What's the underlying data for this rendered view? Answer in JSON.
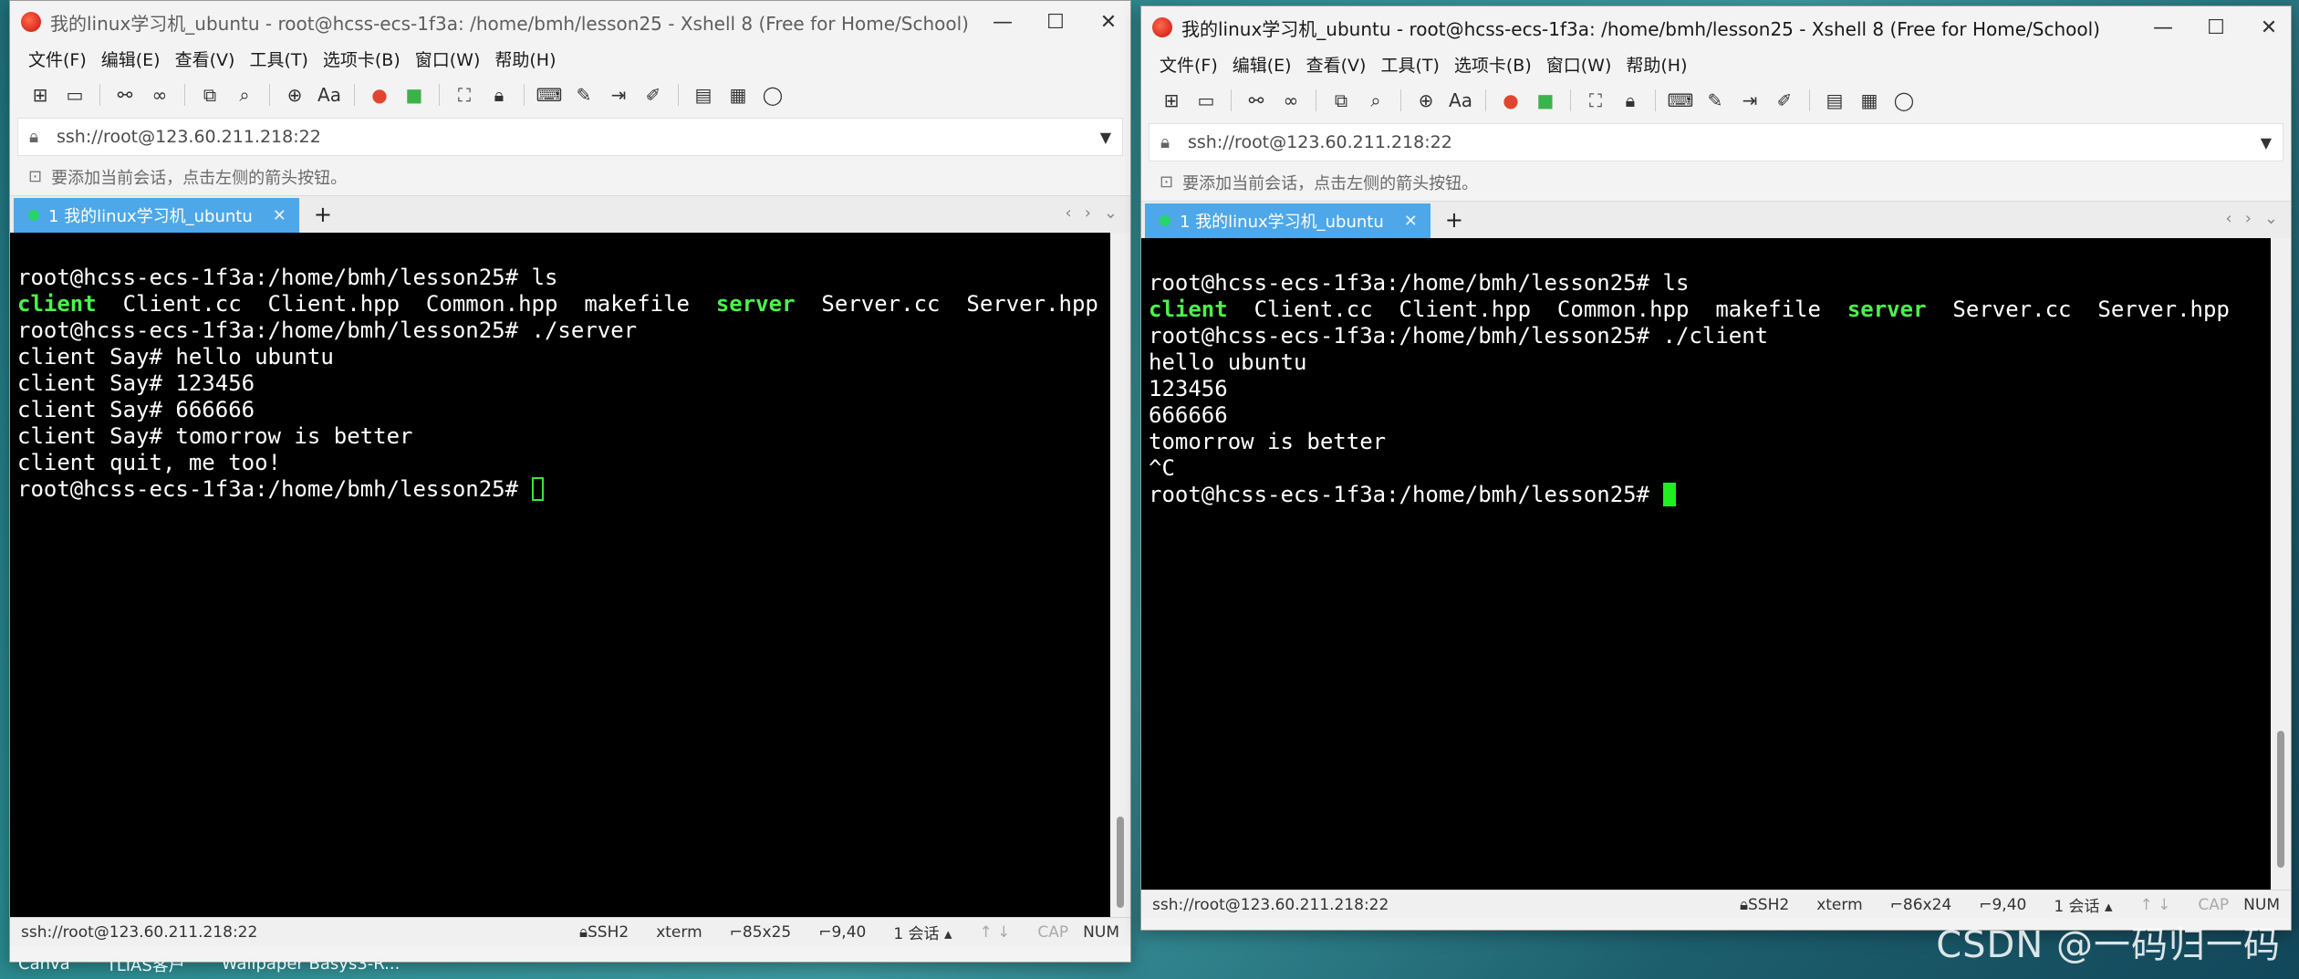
{
  "desktop": {
    "taskbar_items": [
      "Canva",
      "TLIAS客户",
      "Wallpaper Basys3-R..."
    ],
    "watermark": "CSDN @一码归一码"
  },
  "windows": [
    {
      "title": "我的linux学习机_ubuntu - root@hcss-ecs-1f3a: /home/bmh/lesson25 - Xshell 8 (Free for Home/School)",
      "menu": [
        "文件(F)",
        "编辑(E)",
        "查看(V)",
        "工具(T)",
        "选项卡(B)",
        "窗口(W)",
        "帮助(H)"
      ],
      "address": "ssh://root@123.60.211.218:22",
      "hint": "要添加当前会话，点击左侧的箭头按钮。",
      "tab_label": "1 我的linux学习机_ubuntu",
      "terminal": {
        "prompt": "root@hcss-ecs-1f3a:/home/bmh/lesson25#",
        "cmd_ls": " ls",
        "ls_client": "client",
        "ls_mid": "  Client.cc  Client.hpp  Common.hpp  makefile  ",
        "ls_server": "server",
        "ls_end": "  Server.cc  Server.hpp",
        "cmd_run": " ./server",
        "output": [
          "client Say# hello ubuntu",
          "client Say# 123456",
          "client Say# 666666",
          "client Say# tomorrow is better",
          "client quit, me too!"
        ]
      },
      "status": {
        "address": "ssh://root@123.60.211.218:22",
        "protocol": "SSH2",
        "term": "xterm",
        "size": "85x25",
        "pos": "9,40",
        "sessions": "1 会话",
        "cap": "CAP",
        "num": "NUM"
      }
    },
    {
      "title": "我的linux学习机_ubuntu - root@hcss-ecs-1f3a: /home/bmh/lesson25 - Xshell 8 (Free for Home/School)",
      "menu": [
        "文件(F)",
        "编辑(E)",
        "查看(V)",
        "工具(T)",
        "选项卡(B)",
        "窗口(W)",
        "帮助(H)"
      ],
      "address": "ssh://root@123.60.211.218:22",
      "hint": "要添加当前会话，点击左侧的箭头按钮。",
      "tab_label": "1 我的linux学习机_ubuntu",
      "terminal": {
        "prompt": "root@hcss-ecs-1f3a:/home/bmh/lesson25#",
        "cmd_ls": " ls",
        "ls_client": "client",
        "ls_mid": "  Client.cc  Client.hpp  Common.hpp  makefile  ",
        "ls_server": "server",
        "ls_end": "  Server.cc  Server.hpp",
        "cmd_run": " ./client",
        "output": [
          "hello ubuntu",
          "123456",
          "666666",
          "tomorrow is better",
          "^C"
        ]
      },
      "status": {
        "address": "ssh://root@123.60.211.218:22",
        "protocol": "SSH2",
        "term": "xterm",
        "size": "86x24",
        "pos": "9,40",
        "sessions": "1 会话",
        "cap": "CAP",
        "num": "NUM"
      }
    }
  ],
  "colors": {
    "terminal_bg": "#000000",
    "terminal_fg": "#ffffff",
    "ls_highlight": "#4cf24c",
    "tab_active": "#4ea7e8",
    "cursor": "#1ef01e"
  }
}
